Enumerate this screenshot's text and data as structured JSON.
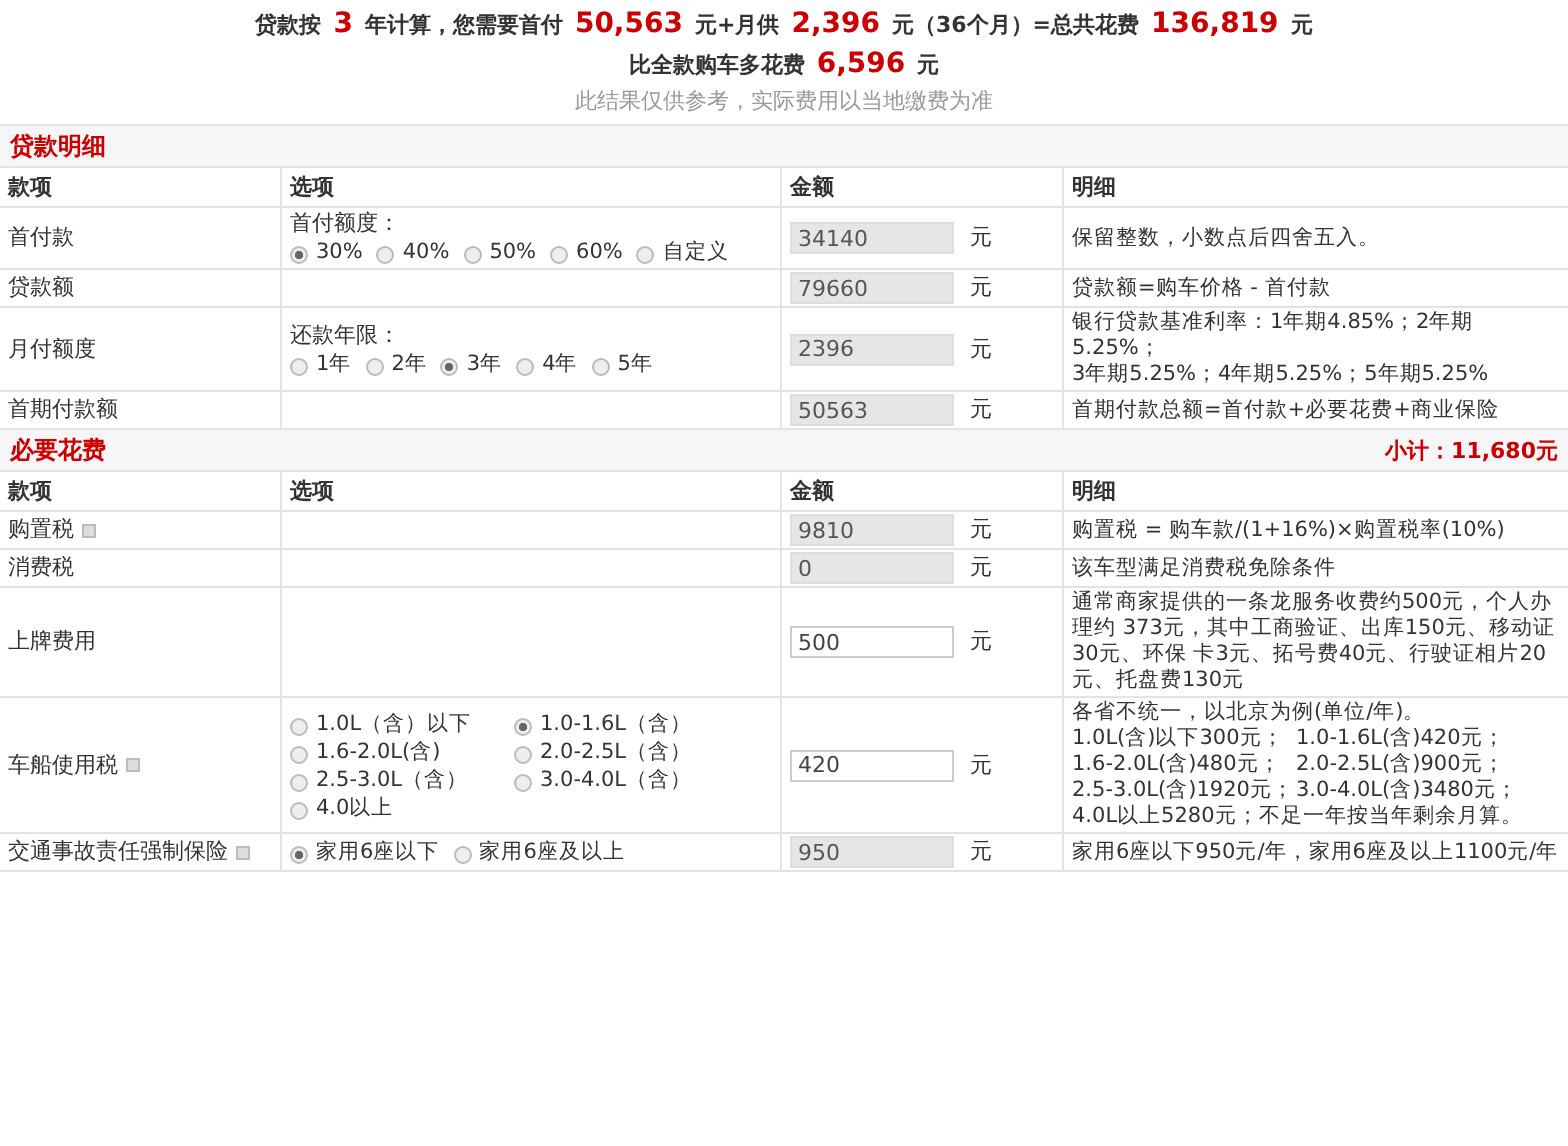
{
  "summary": {
    "lines": [
      [
        {
          "text": "贷款按",
          "emphasis": false
        },
        {
          "text": "3",
          "emphasis": true
        },
        {
          "text": "年计算，您需要首付",
          "emphasis": false
        },
        {
          "text": "50,563",
          "emphasis": true
        },
        {
          "text": "元+月供",
          "emphasis": false
        },
        {
          "text": "2,396",
          "emphasis": true
        },
        {
          "text": "元（36个月）=总共花费",
          "emphasis": false
        },
        {
          "text": "136,819",
          "emphasis": true
        },
        {
          "text": "元",
          "emphasis": false
        }
      ],
      [
        {
          "text": "比全款购车多花费",
          "emphasis": false
        },
        {
          "text": "6,596",
          "emphasis": true
        },
        {
          "text": "元",
          "emphasis": false
        }
      ]
    ],
    "note": "此结果仅供参考，实际费用以当地缴费为准"
  },
  "sections": [
    {
      "title": "贷款明细",
      "columns": [
        "款项",
        "选项",
        "金额",
        "明细"
      ],
      "rows": [
        {
          "label": "首付款",
          "info": false,
          "options": {
            "label": "首付额度：",
            "kind": "inline",
            "items": [
              {
                "text": "30%",
                "selected": true
              },
              {
                "text": "40%",
                "selected": false
              },
              {
                "text": "50%",
                "selected": false
              },
              {
                "text": "60%",
                "selected": false
              },
              {
                "text": "自定义",
                "selected": false
              }
            ]
          },
          "amount": {
            "value": "34140",
            "editable": false
          },
          "unit": "元",
          "detail": {
            "kind": "text",
            "lines": [
              "保留整数，小数点后四舍五入。"
            ]
          }
        },
        {
          "label": "贷款额",
          "info": false,
          "amount": {
            "value": "79660",
            "editable": false
          },
          "unit": "元",
          "detail": {
            "kind": "text",
            "lines": [
              "贷款额=购车价格 - 首付款"
            ]
          }
        },
        {
          "label": "月付额度",
          "info": false,
          "options": {
            "label": "还款年限：",
            "kind": "inline",
            "items": [
              {
                "text": "1年",
                "selected": false
              },
              {
                "text": "2年",
                "selected": false
              },
              {
                "text": "3年",
                "selected": true
              },
              {
                "text": "4年",
                "selected": false
              },
              {
                "text": "5年",
                "selected": false
              }
            ]
          },
          "amount": {
            "value": "2396",
            "editable": false
          },
          "unit": "元",
          "detail": {
            "kind": "text",
            "lines": [
              "银行贷款基准利率：1年期4.85%；2年期5.25%；",
              "3年期5.25%；4年期5.25%；5年期5.25%"
            ]
          }
        },
        {
          "label": "首期付款额",
          "info": false,
          "amount": {
            "value": "50563",
            "editable": false
          },
          "unit": "元",
          "detail": {
            "kind": "text",
            "lines": [
              "首期付款总额=首付款+必要花费+商业保险"
            ]
          }
        }
      ]
    },
    {
      "title": "必要花费",
      "subtotal": "小计：11,680元",
      "columns": [
        "款项",
        "选项",
        "金额",
        "明细"
      ],
      "rows": [
        {
          "label": "购置税",
          "info": true,
          "amount": {
            "value": "9810",
            "editable": false
          },
          "unit": "元",
          "detail": {
            "kind": "text",
            "lines": [
              "购置税 = 购车款/(1+16%)×购置税率(10%)"
            ]
          }
        },
        {
          "label": "消费税",
          "info": false,
          "amount": {
            "value": "0",
            "editable": false
          },
          "unit": "元",
          "detail": {
            "kind": "text",
            "lines": [
              "该车型满足消费税免除条件"
            ]
          }
        },
        {
          "label": "上牌费用",
          "info": false,
          "amount": {
            "value": "500",
            "editable": true
          },
          "unit": "元",
          "detail": {
            "kind": "text",
            "lines": [
              "通常商家提供的一条龙服务收费约500元，个人办理约 373元，其中工商验证、出库150元、移动证30元、环保 卡3元、拓号费40元、行驶证相片20元、托盘费130元"
            ]
          }
        },
        {
          "label": "车船使用税",
          "info": true,
          "options": {
            "kind": "grid",
            "items": [
              {
                "text": "1.0L（含）以下",
                "selected": false
              },
              {
                "text": "1.0-1.6L（含）",
                "selected": true
              },
              {
                "text": "1.6-2.0L(含)",
                "selected": false
              },
              {
                "text": "2.0-2.5L（含）",
                "selected": false
              },
              {
                "text": "2.5-3.0L（含）",
                "selected": false
              },
              {
                "text": "3.0-4.0L（含）",
                "selected": false
              },
              {
                "text": "4.0以上",
                "selected": false
              }
            ]
          },
          "amount": {
            "value": "420",
            "editable": true
          },
          "unit": "元",
          "detail": {
            "kind": "rates",
            "intro": "各省不统一，以北京为例(单位/年)。",
            "rates": [
              "1.0L(含)以下300元；",
              "1.0-1.6L(含)420元；",
              "1.6-2.0L(含)480元；",
              "2.0-2.5L(含)900元；",
              "2.5-3.0L(含)1920元；",
              "3.0-4.0L(含)3480元；"
            ],
            "footer": "4.0L以上5280元；不足一年按当年剩余月算。"
          }
        },
        {
          "label": "交通事故责任强制保险",
          "info": true,
          "options": {
            "kind": "inline",
            "items": [
              {
                "text": "家用6座以下",
                "selected": true
              },
              {
                "text": "家用6座及以上",
                "selected": false
              }
            ]
          },
          "amount": {
            "value": "950",
            "editable": false
          },
          "unit": "元",
          "detail": {
            "kind": "text",
            "lines": [
              "家用6座以下950元/年，家用6座及以上1100元/年"
            ]
          }
        }
      ]
    }
  ]
}
